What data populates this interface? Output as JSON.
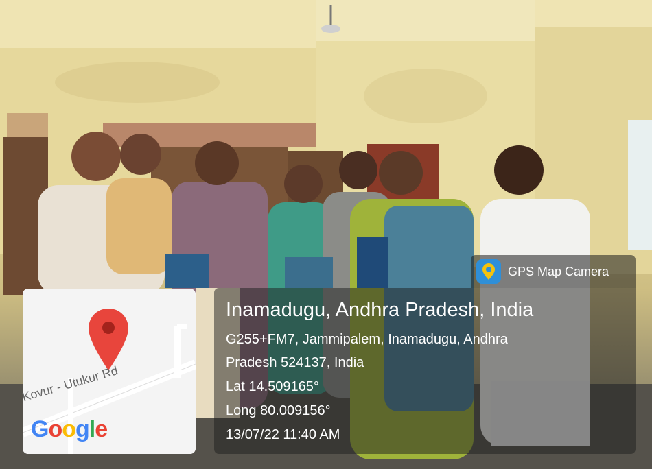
{
  "map": {
    "road_label": "Kovur - Utukur Rd",
    "logo_text": "Google",
    "pin_color": "#e8453c"
  },
  "badge": {
    "app_name": "GPS Map Camera",
    "icon": "location-pin-icon"
  },
  "location": {
    "title": "Inamadugu, Andhra Pradesh, India",
    "address_line1": "G255+FM7, Jammipalem, Inamadugu, Andhra",
    "address_line2": "Pradesh 524137, India",
    "latitude": "Lat 14.509165°",
    "longitude": "Long 80.009156°",
    "datetime": "13/07/22 11:40 AM"
  }
}
